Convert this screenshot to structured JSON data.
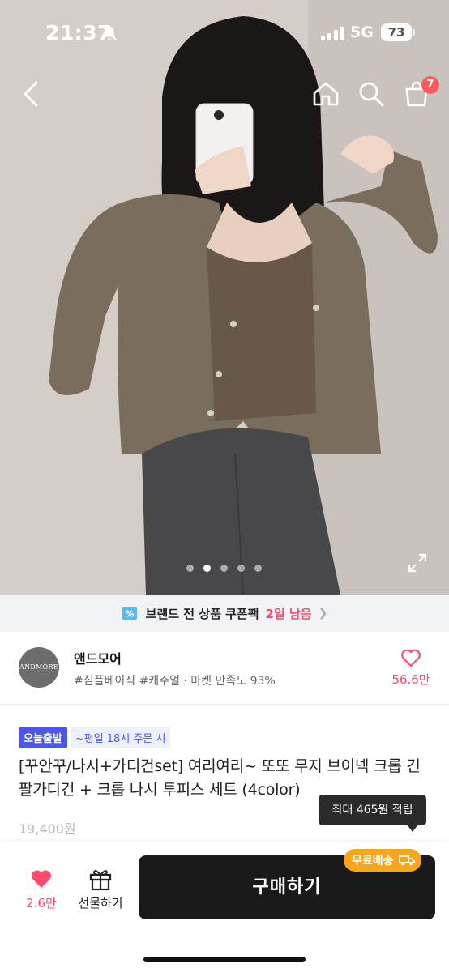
{
  "status": {
    "time": "21:37",
    "network": "5G",
    "battery": "73"
  },
  "nav": {
    "cart_count": "7"
  },
  "gallery": {
    "page_count": 5,
    "active_index": 1
  },
  "coupon": {
    "text": "브랜드 전 상품 쿠폰팩",
    "remain": "2일 남음"
  },
  "shop": {
    "logo_text": "ANDMORE",
    "name": "앤드모어",
    "tags": "#심플베이직 #캐주얼 · 마켓 만족도 93%",
    "like_count": "56.6만"
  },
  "product": {
    "badge_today": "오늘출발",
    "badge_time": "~평일 18시 주문 시",
    "title": "[꾸안꾸/나시+가디건set] 여리여리~ 또또 무지 브이넥 크롭 긴팔가디건 + 크롭 나시 투피스 세트 (4color)",
    "original_price": "19,400원"
  },
  "tooltip": {
    "text": "최대 465원 적립"
  },
  "bottom": {
    "like_count": "2.6만",
    "gift_label": "선물하기",
    "buy_label": "구매하기",
    "shipping_badge": "무료배송"
  },
  "colors": {
    "accent_pink": "#ff4b6e",
    "badge_blue": "#4c57e8",
    "shipping_orange": "#f7a51b",
    "buy_button": "#1a1a1a"
  }
}
